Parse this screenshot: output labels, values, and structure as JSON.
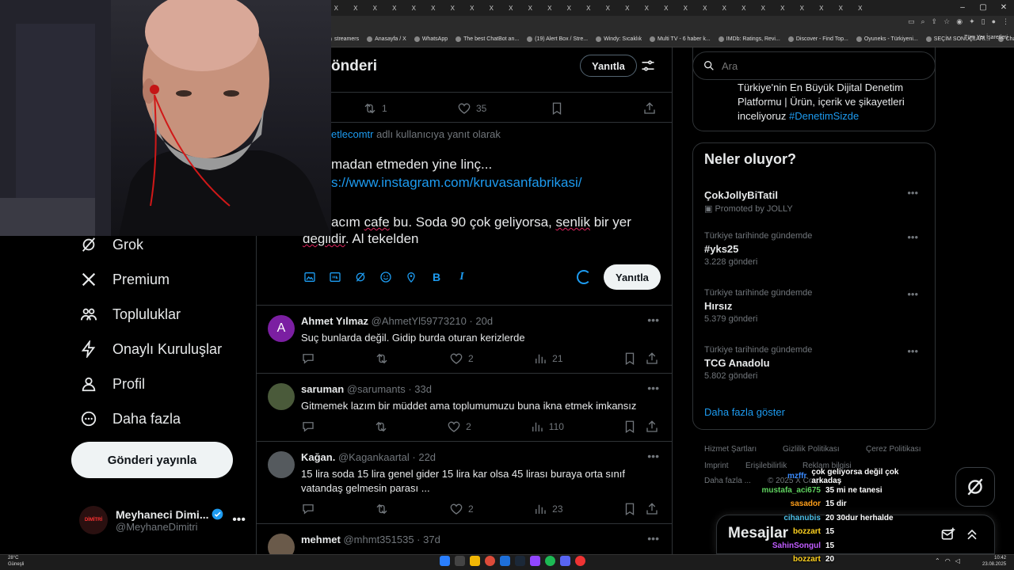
{
  "browser": {
    "tab_label": "X",
    "tab_count": 28,
    "bookmarks": [
      "streamers",
      "Anasayfa / X",
      "WhatsApp",
      "The best ChatBot an...",
      "(19) Alert Box / Stre...",
      "Windy: Sıcaklık",
      "Multi TV - 6 haber k...",
      "IMDb: Ratings, Revi...",
      "Discover - Find Top...",
      "Oyuneks - Türkiyeni...",
      "SEÇİM SONUÇLARI...",
      "ChatGPT"
    ],
    "all_bookmarks": "Tüm Yer İşaretleri"
  },
  "nav": {
    "items": [
      {
        "label": "Grok",
        "icon": "grok-icon"
      },
      {
        "label": "Premium",
        "icon": "x-logo-icon"
      },
      {
        "label": "Topluluklar",
        "icon": "communities-icon"
      },
      {
        "label": "Onaylı Kuruluşlar",
        "icon": "lightning-icon"
      },
      {
        "label": "Profil",
        "icon": "person-icon"
      },
      {
        "label": "Daha fazla",
        "icon": "more-circle-icon"
      }
    ],
    "post_button": "Gönderi yayınla",
    "profile": {
      "name": "Meyhaneci Dimi...",
      "handle": "@MeyhaneDimitri",
      "avatar_text": "DİMİTRİ"
    }
  },
  "header": {
    "title": "önderi",
    "reply_button": "Yanıtla"
  },
  "main_post": {
    "retweets": "1",
    "likes": "35"
  },
  "composer": {
    "replying_handle": "etlecomtr",
    "replying_suffix": "adlı kullanıcıya yanıt olarak",
    "line1": "madan etmeden yine linç...",
    "link": "s://www.instagram.com/kruvasanfabrikasi/",
    "line3_a": "acım ",
    "line3_b": "cafe",
    "line3_c": " bu. Soda 90 çok geliyorsa, ",
    "line3_d": "senlik",
    "line3_e": " bir yer",
    "line4_a": "",
    "line4_b": "değildir",
    "line4_c": ". Al tekelden",
    "reply_button": "Yanıtla"
  },
  "replies": [
    {
      "name": "Ahmet Yılmaz",
      "handle": "@AhmetYl59773210",
      "time": "20d",
      "text": "Suç bunlarda değil. Gidip burda oturan kerizlerde",
      "likes": "2",
      "views": "21",
      "avatar_letter": "A",
      "avatar_color": "#7b1fa2"
    },
    {
      "name": "saruman",
      "handle": "@sarumants",
      "time": "33d",
      "text": "Gitmemek lazım bir müddet ama toplumumuzu buna ikna etmek imkansız",
      "likes": "2",
      "views": "110",
      "avatar_letter": "",
      "avatar_color": "#4a5a3a"
    },
    {
      "name": "Kağan.",
      "handle": "@Kagankaartal",
      "time": "22d",
      "text": "15 lira soda 15 lira genel gider 15 lira kar olsa 45 lirası buraya orta sınıf vatandaş gelmesin parası ...",
      "likes": "2",
      "views": "23",
      "avatar_letter": "",
      "avatar_color": "#555a5e"
    },
    {
      "name": "mehmet",
      "handle": "@mhmt351535",
      "time": "37d",
      "text": "",
      "likes": "",
      "views": "",
      "avatar_letter": "",
      "avatar_color": "#6a5a4a"
    }
  ],
  "right": {
    "search_placeholder": "Ara",
    "promo_text": "Türkiye'nin En Büyük Dijital Denetim Platformu | Ürün, içerik ve şikayetleri inceliyoruz ",
    "promo_tag": "#DenetimSizde",
    "trends_title": "Neler oluyor?",
    "trends": [
      {
        "context": "",
        "name": "ÇokJollyBiTatil",
        "count": "Promoted by JOLLY",
        "promoted": true
      },
      {
        "context": "Türkiye tarihinde gündemde",
        "name": "#yks25",
        "count": "3.228 gönderi",
        "promoted": false
      },
      {
        "context": "Türkiye tarihinde gündemde",
        "name": "Hırsız",
        "count": "5.379 gönderi",
        "promoted": false
      },
      {
        "context": "Türkiye tarihinde gündemde",
        "name": "TCG Anadolu",
        "count": "5.802 gönderi",
        "promoted": false
      }
    ],
    "show_more": "Daha fazla göster",
    "footer": [
      "Hizmet Şartları",
      "Gizlilik Politikası",
      "Çerez Politikası",
      "Imprint",
      "Erişilebilirlik",
      "Reklam bilgisi",
      "Daha fazla ...",
      "© 2025 X Corp."
    ]
  },
  "messages": {
    "title": "Mesajlar"
  },
  "chat": [
    {
      "user": "mzffr",
      "msg": "çok geliyorsa değil çok arkadaş",
      "color": "#3a8bff"
    },
    {
      "user": "mustafa_aci675",
      "msg": "35 mi ne tanesi",
      "color": "#5fd35f"
    },
    {
      "user": "sasador",
      "msg": "15 dir",
      "color": "#ff9f1a"
    },
    {
      "user": "cihanubis",
      "msg": "20 30dur herhalde",
      "color": "#4fc1e9"
    },
    {
      "user": "bozzart",
      "msg": "15",
      "color": "#ffd21f"
    },
    {
      "user": "SahinSongul",
      "msg": "15",
      "color": "#c05cff"
    },
    {
      "user": "bozzart",
      "msg": "20",
      "color": "#ffd21f"
    }
  ],
  "taskbar": {
    "temp": "28°C",
    "weather": "Güneşli",
    "time": "10:42",
    "date": "23.08.2025"
  }
}
